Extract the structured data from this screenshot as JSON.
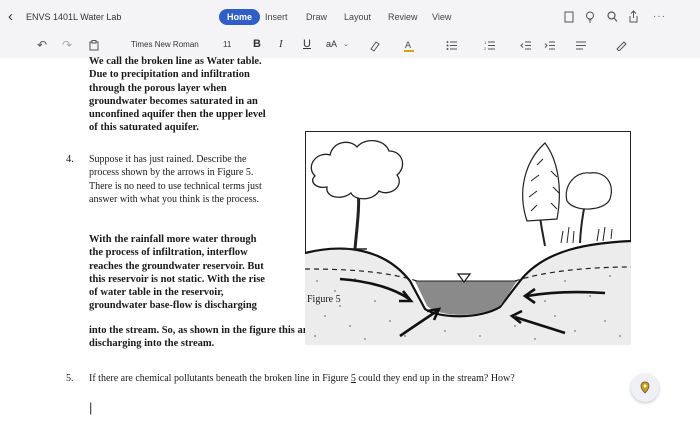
{
  "header": {
    "doc_title": "ENVS 1401L Water Lab",
    "tabs": [
      "Home",
      "Insert",
      "Draw",
      "Layout",
      "Review",
      "View"
    ],
    "active_tab": "Home",
    "more": "···"
  },
  "toolbar": {
    "font_name": "Times New Roman",
    "font_size": "11",
    "bold": "B",
    "italic": "I",
    "underline": "U",
    "font_effects": "aA"
  },
  "content": {
    "para1_lines": [
      "We call the broken line as Water table.",
      "Due to precipitation and infiltration",
      "through the porous layer when",
      "groundwater becomes saturated in an",
      "unconfined aquifer then the upper level",
      "of this saturated aquifer."
    ],
    "q4": {
      "number": "4.",
      "lines": [
        "Suppose it has just rained. Describe the",
        "process shown by the arrows in Figure 5.",
        "There is no need to use technical terms just",
        "answer with what you think is the process."
      ]
    },
    "answer_lines": [
      "With the rainfall more water through",
      "the process of infiltration, interflow",
      "reaches the groundwater reservoir. But",
      "this reservoir is not static. With the rise",
      "of water table in the reservoir,",
      "groundwater base-flow is discharging",
      "into the stream. So, as shown in the figure this arrow indicates that the groundwater base-flow is",
      "discharging into the stream."
    ],
    "figure_caption": "Figure 5",
    "q5": {
      "number": "5.",
      "text_before": "If there are chemical pollutants beneath the broken line in Figure ",
      "link_ref": "5",
      "text_after": " could they end up in the stream? How?"
    },
    "cursor": "|"
  }
}
